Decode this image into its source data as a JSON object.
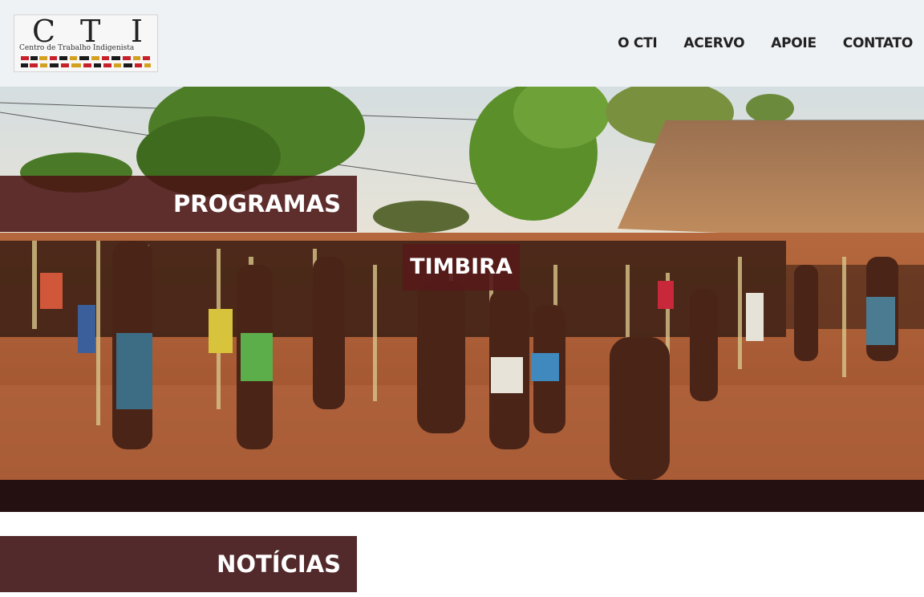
{
  "logo": {
    "letters": [
      "C",
      "T",
      "I"
    ],
    "subtitle": "Centro de Trabalho Indigenista"
  },
  "nav": {
    "items": [
      {
        "label": "O CTI"
      },
      {
        "label": "ACERVO"
      },
      {
        "label": "APOIE"
      },
      {
        "label": "CONTATO"
      }
    ]
  },
  "hero": {
    "programs_label": "PROGRAMAS",
    "program_name": "TIMBIRA",
    "image_subject": "ceremony-crowd-photo"
  },
  "news": {
    "heading": "NOTÍCIAS"
  },
  "colors": {
    "label_bg": "#4b1414",
    "news_bg": "#532a2b",
    "hero_bar": "#241010",
    "header_bg": "#eef2f5"
  }
}
